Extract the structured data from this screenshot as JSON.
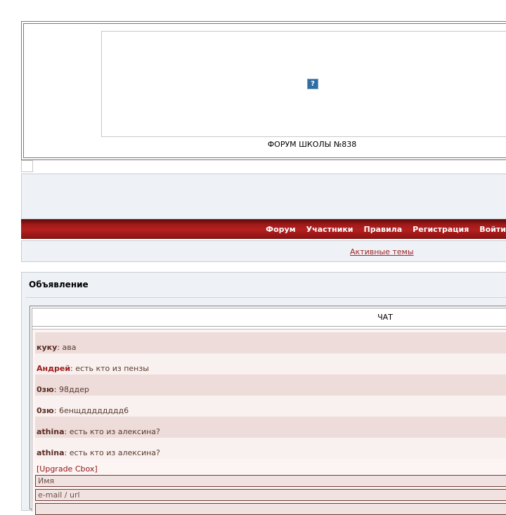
{
  "header": {
    "broken_image_glyph": "?",
    "site_title": "ФОРУМ ШКОЛЫ №838"
  },
  "nav": {
    "items": [
      "Форум",
      "Участники",
      "Правила",
      "Регистрация",
      "Войти"
    ]
  },
  "active_topics": {
    "label": "Активные темы"
  },
  "announcement": {
    "title": "Объявление",
    "chat_title": "ЧАТ",
    "messages": [
      {
        "author": "куку",
        "text": ": ава"
      },
      {
        "author": "Андрей",
        "text": ": есть кто из пензы"
      },
      {
        "author": "0зю",
        "text": ": 98ддер"
      },
      {
        "author": "0зю",
        "text": ": 6енщдддддддд6"
      },
      {
        "author": "athina",
        "text": ": есть кто из алексина?"
      },
      {
        "author": "athina",
        "text": ": есть кто из алексина?"
      }
    ],
    "upgrade_link": "[Upgrade Cbox]",
    "name_placeholder": "Имя",
    "url_placeholder": "e-mail / url"
  },
  "colors": {
    "nav_red": "#a31a1a",
    "link_red": "#a0242a",
    "panel_bg": "#eef2f6",
    "chat_row_odd": "#eddcda",
    "chat_row_even": "#f9f1ef"
  }
}
